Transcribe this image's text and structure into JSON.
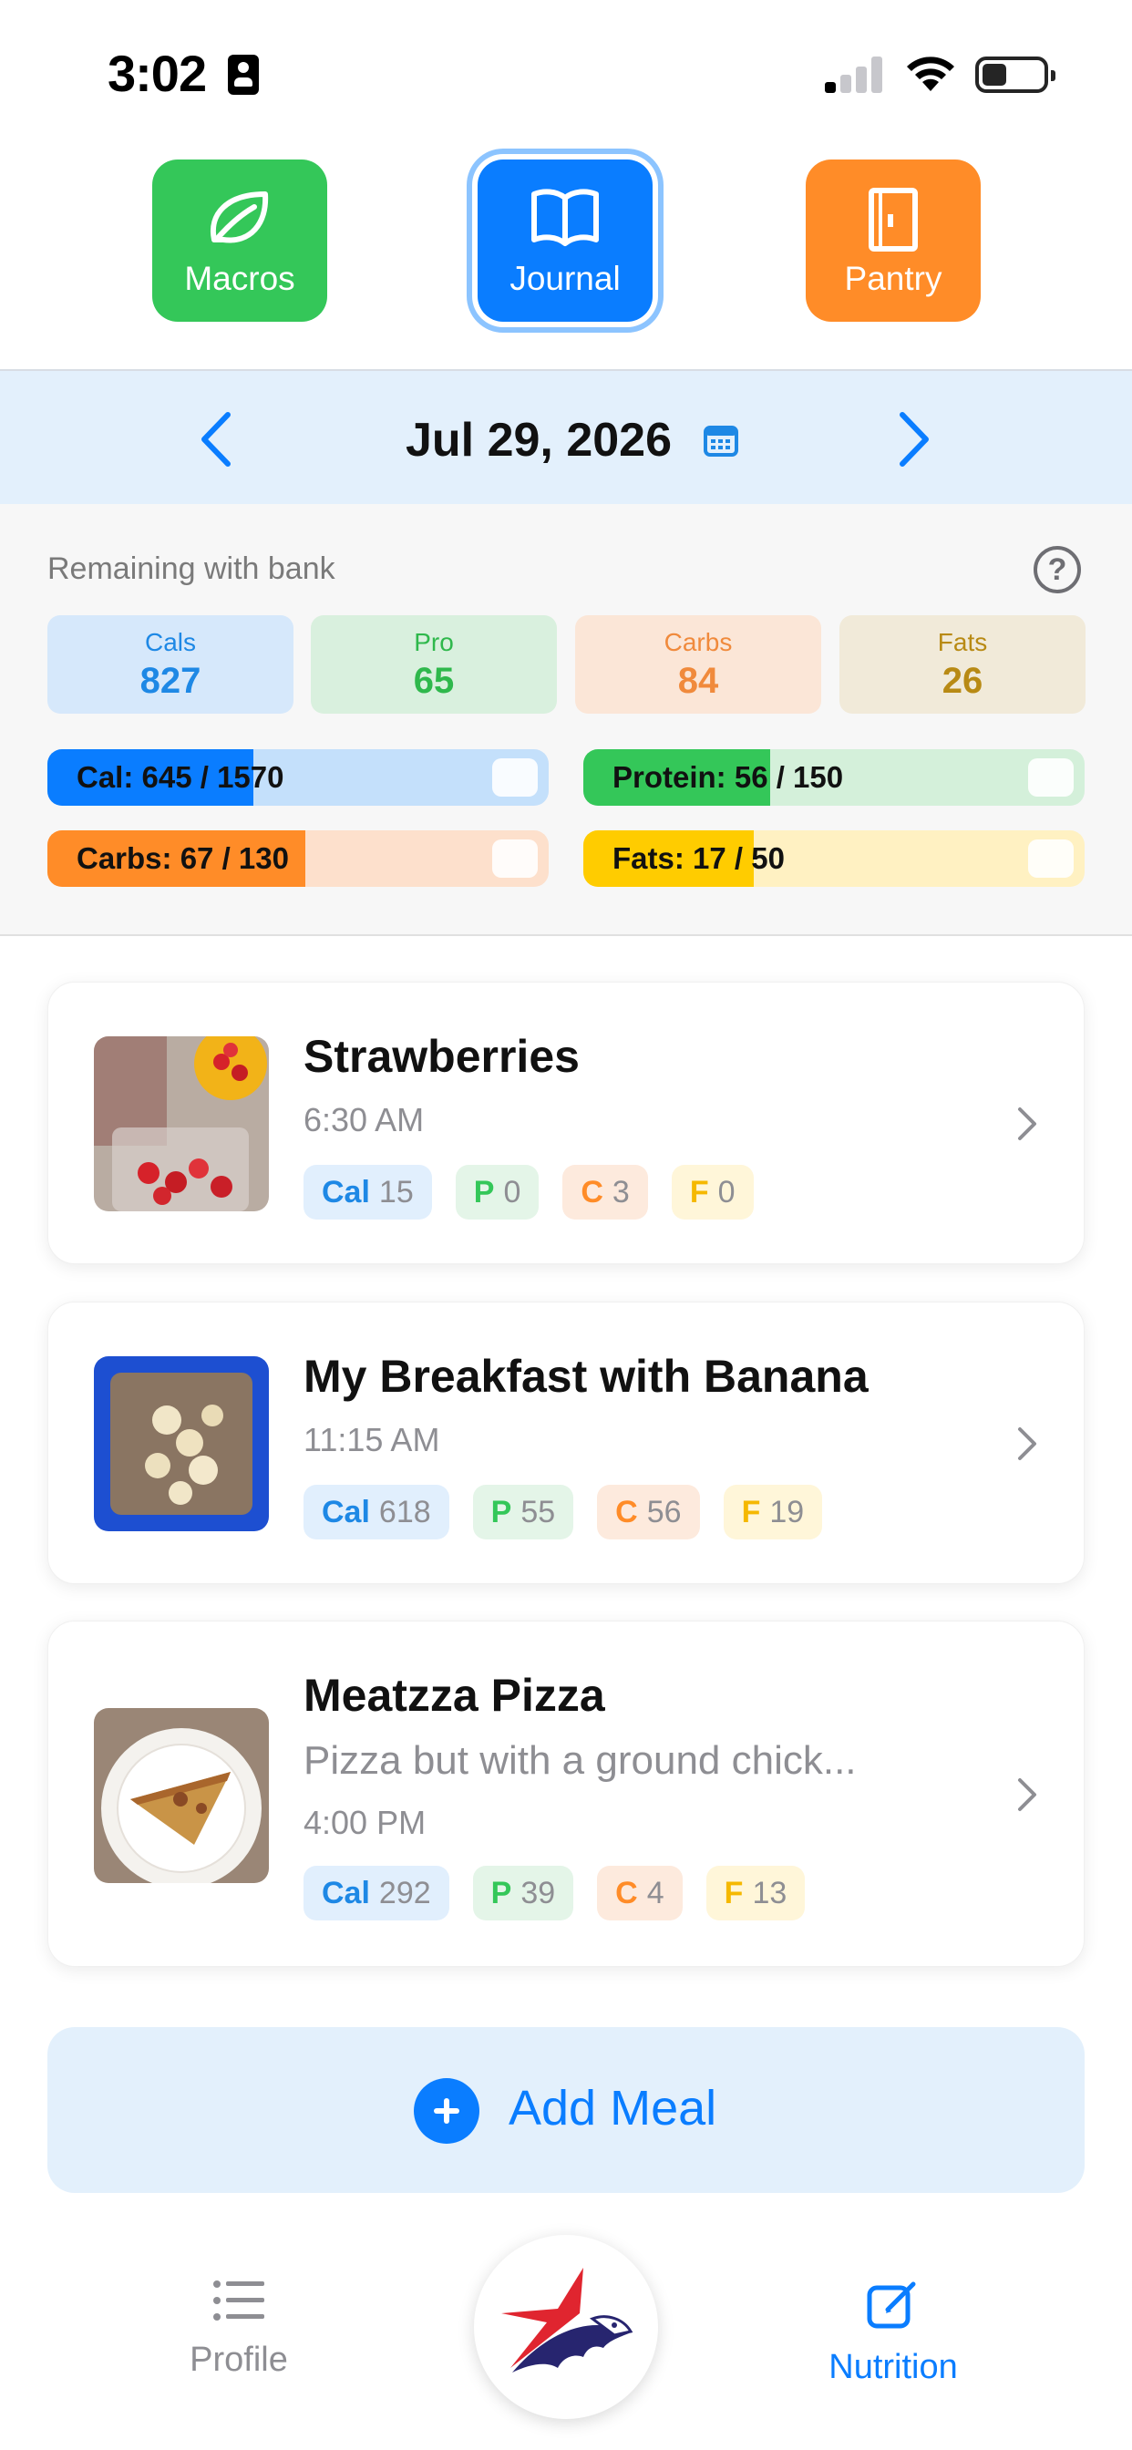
{
  "status_bar": {
    "time": "3:02"
  },
  "top_tabs": {
    "macros_label": "Macros",
    "journal_label": "Journal",
    "pantry_label": "Pantry",
    "active": "Journal"
  },
  "date_bar": {
    "date": "Jul 29, 2026"
  },
  "remaining": {
    "title": "Remaining with bank",
    "help": "?",
    "boxes": [
      {
        "label": "Cals",
        "value": "827"
      },
      {
        "label": "Pro",
        "value": "65"
      },
      {
        "label": "Carbs",
        "value": "84"
      },
      {
        "label": "Fats",
        "value": "26"
      }
    ],
    "bars": [
      {
        "text": "Cal: 645 / 1570",
        "fraction": 0.411
      },
      {
        "text": "Protein: 56 / 150",
        "fraction": 0.373
      },
      {
        "text": "Carbs: 67 / 130",
        "fraction": 0.515
      },
      {
        "text": "Fats: 17 / 50",
        "fraction": 0.34
      }
    ]
  },
  "meals": [
    {
      "name": "Strawberries",
      "time": "6:30 AM",
      "cal_label": "Cal",
      "cal": "15",
      "p_label": "P",
      "p": "0",
      "c_label": "C",
      "c": "3",
      "f_label": "F",
      "f": "0"
    },
    {
      "name": "My Breakfast with Banana",
      "time": "11:15 AM",
      "cal_label": "Cal",
      "cal": "618",
      "p_label": "P",
      "p": "55",
      "c_label": "C",
      "c": "56",
      "f_label": "F",
      "f": "19"
    },
    {
      "name": "Meatzza Pizza",
      "description": "Pizza but with a ground chick...",
      "time": "4:00 PM",
      "cal_label": "Cal",
      "cal": "292",
      "p_label": "P",
      "p": "39",
      "c_label": "C",
      "c": "4",
      "f_label": "F",
      "f": "13"
    }
  ],
  "add_meal": {
    "label": "Add Meal"
  },
  "bottom_nav": {
    "profile_label": "Profile",
    "nutrition_label": "Nutrition",
    "active": "Nutrition"
  },
  "colors": {
    "blue": "#0a7dff",
    "green": "#34c759",
    "orange": "#ff8c28",
    "yellow": "#ffcc00"
  },
  "icons": {
    "macros": "leaf-icon",
    "journal": "book-icon",
    "pantry": "door-icon",
    "profile": "list-icon",
    "nutrition": "edit-icon",
    "logo": "eagle-star-logo"
  }
}
